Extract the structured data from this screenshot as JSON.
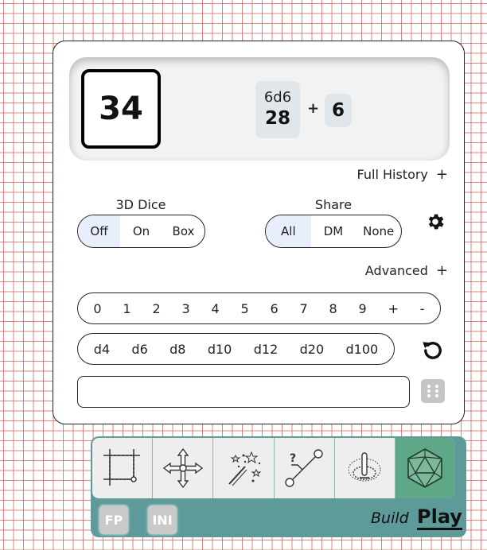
{
  "roll": {
    "total": "34",
    "dice_spec": "6d6",
    "dice_value": "28",
    "operator": "+",
    "modifier": "6"
  },
  "history_link": {
    "label": "Full History",
    "icon": "+"
  },
  "dice3d": {
    "label": "3D Dice",
    "options": [
      "Off",
      "On",
      "Box"
    ],
    "selected": "Off"
  },
  "share": {
    "label": "Share",
    "options": [
      "All",
      "DM",
      "None"
    ],
    "selected": "All"
  },
  "advanced_link": {
    "label": "Advanced",
    "icon": "+"
  },
  "number_keys": [
    "0",
    "1",
    "2",
    "3",
    "4",
    "5",
    "6",
    "7",
    "8",
    "9",
    "+",
    "-"
  ],
  "die_keys": [
    "d4",
    "d6",
    "d8",
    "d10",
    "d12",
    "d20",
    "d100"
  ],
  "custom_input": {
    "value": "",
    "placeholder": ""
  },
  "toolbar": {
    "tools": [
      "select-tool-icon",
      "move-tool-icon",
      "effects-tool-icon",
      "measure-tool-icon",
      "fog-tool-icon",
      "dice-tool-icon"
    ],
    "active": "dice-tool-icon"
  },
  "modes": {
    "build": "Build",
    "play": "Play",
    "active": "Play"
  },
  "mini_buttons": {
    "fp": "FP",
    "ini": "INI"
  },
  "colors": {
    "grid_line": "#d25a5a",
    "accent_teal": "#5f9a9a",
    "active_tool": "#5ea887",
    "selected_option": "#e8eefc",
    "chip_bg": "#e1e6ea"
  }
}
